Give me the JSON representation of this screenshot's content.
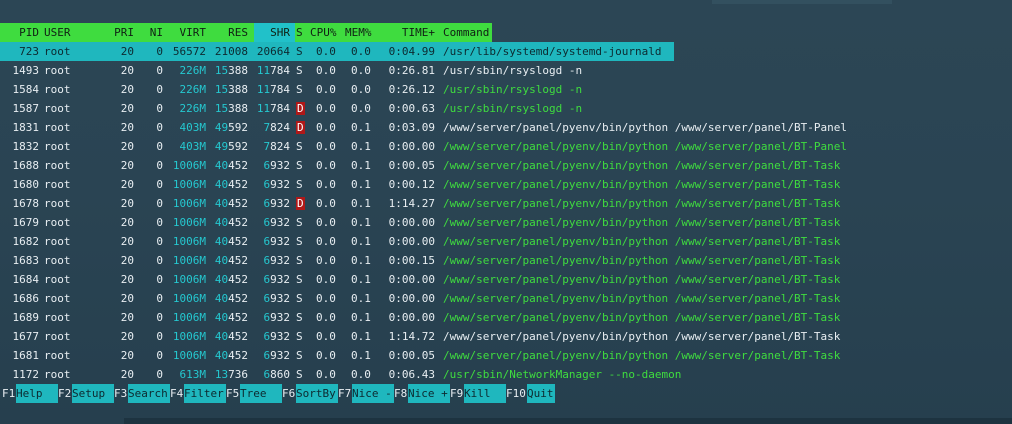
{
  "header": {
    "pid": "PID",
    "user": "USER",
    "pri": "PRI",
    "ni": "NI",
    "virt": "VIRT",
    "res": "RES",
    "shr": "SHR",
    "s": "S",
    "cpu": "CPU%",
    "mem": "MEM%",
    "time": "TIME+",
    "command": "Command"
  },
  "processes": [
    {
      "pid": "723",
      "user": "root",
      "pri": "20",
      "ni": "0",
      "virt": "56572",
      "res": "21008",
      "shr": "20664",
      "s": "S",
      "cpu": "0.0",
      "mem": "0.0",
      "time": "0:04.99",
      "command": "/usr/lib/systemd/systemd-journald"
    },
    {
      "pid": "1493",
      "user": "root",
      "pri": "20",
      "ni": "0",
      "virt": "226M",
      "res": "15388",
      "shr": "11784",
      "s": "S",
      "cpu": "0.0",
      "mem": "0.0",
      "time": "0:26.81",
      "command": "/usr/sbin/rsyslogd -n"
    },
    {
      "pid": "1584",
      "user": "root",
      "pri": "20",
      "ni": "0",
      "virt": "226M",
      "res": "15388",
      "shr": "11784",
      "s": "S",
      "cpu": "0.0",
      "mem": "0.0",
      "time": "0:26.12",
      "command": "/usr/sbin/rsyslogd -n"
    },
    {
      "pid": "1587",
      "user": "root",
      "pri": "20",
      "ni": "0",
      "virt": "226M",
      "res": "15388",
      "shr": "11784",
      "s": "D",
      "cpu": "0.0",
      "mem": "0.0",
      "time": "0:00.63",
      "command": "/usr/sbin/rsyslogd -n"
    },
    {
      "pid": "1831",
      "user": "root",
      "pri": "20",
      "ni": "0",
      "virt": "403M",
      "res": "49592",
      "shr": "7824",
      "s": "D",
      "cpu": "0.0",
      "mem": "0.1",
      "time": "0:03.09",
      "command": "/www/server/panel/pyenv/bin/python /www/server/panel/BT-Panel"
    },
    {
      "pid": "1832",
      "user": "root",
      "pri": "20",
      "ni": "0",
      "virt": "403M",
      "res": "49592",
      "shr": "7824",
      "s": "S",
      "cpu": "0.0",
      "mem": "0.1",
      "time": "0:00.00",
      "command": "/www/server/panel/pyenv/bin/python /www/server/panel/BT-Panel"
    },
    {
      "pid": "1688",
      "user": "root",
      "pri": "20",
      "ni": "0",
      "virt": "1006M",
      "res": "40452",
      "shr": "6932",
      "s": "S",
      "cpu": "0.0",
      "mem": "0.1",
      "time": "0:00.05",
      "command": "/www/server/panel/pyenv/bin/python /www/server/panel/BT-Task"
    },
    {
      "pid": "1680",
      "user": "root",
      "pri": "20",
      "ni": "0",
      "virt": "1006M",
      "res": "40452",
      "shr": "6932",
      "s": "S",
      "cpu": "0.0",
      "mem": "0.1",
      "time": "0:00.12",
      "command": "/www/server/panel/pyenv/bin/python /www/server/panel/BT-Task"
    },
    {
      "pid": "1678",
      "user": "root",
      "pri": "20",
      "ni": "0",
      "virt": "1006M",
      "res": "40452",
      "shr": "6932",
      "s": "D",
      "cpu": "0.0",
      "mem": "0.1",
      "time": "1:14.27",
      "command": "/www/server/panel/pyenv/bin/python /www/server/panel/BT-Task"
    },
    {
      "pid": "1679",
      "user": "root",
      "pri": "20",
      "ni": "0",
      "virt": "1006M",
      "res": "40452",
      "shr": "6932",
      "s": "S",
      "cpu": "0.0",
      "mem": "0.1",
      "time": "0:00.00",
      "command": "/www/server/panel/pyenv/bin/python /www/server/panel/BT-Task"
    },
    {
      "pid": "1682",
      "user": "root",
      "pri": "20",
      "ni": "0",
      "virt": "1006M",
      "res": "40452",
      "shr": "6932",
      "s": "S",
      "cpu": "0.0",
      "mem": "0.1",
      "time": "0:00.00",
      "command": "/www/server/panel/pyenv/bin/python /www/server/panel/BT-Task"
    },
    {
      "pid": "1683",
      "user": "root",
      "pri": "20",
      "ni": "0",
      "virt": "1006M",
      "res": "40452",
      "shr": "6932",
      "s": "S",
      "cpu": "0.0",
      "mem": "0.1",
      "time": "0:00.15",
      "command": "/www/server/panel/pyenv/bin/python /www/server/panel/BT-Task"
    },
    {
      "pid": "1684",
      "user": "root",
      "pri": "20",
      "ni": "0",
      "virt": "1006M",
      "res": "40452",
      "shr": "6932",
      "s": "S",
      "cpu": "0.0",
      "mem": "0.1",
      "time": "0:00.00",
      "command": "/www/server/panel/pyenv/bin/python /www/server/panel/BT-Task"
    },
    {
      "pid": "1686",
      "user": "root",
      "pri": "20",
      "ni": "0",
      "virt": "1006M",
      "res": "40452",
      "shr": "6932",
      "s": "S",
      "cpu": "0.0",
      "mem": "0.1",
      "time": "0:00.00",
      "command": "/www/server/panel/pyenv/bin/python /www/server/panel/BT-Task"
    },
    {
      "pid": "1689",
      "user": "root",
      "pri": "20",
      "ni": "0",
      "virt": "1006M",
      "res": "40452",
      "shr": "6932",
      "s": "S",
      "cpu": "0.0",
      "mem": "0.1",
      "time": "0:00.00",
      "command": "/www/server/panel/pyenv/bin/python /www/server/panel/BT-Task"
    },
    {
      "pid": "1677",
      "user": "root",
      "pri": "20",
      "ni": "0",
      "virt": "1006M",
      "res": "40452",
      "shr": "6932",
      "s": "S",
      "cpu": "0.0",
      "mem": "0.1",
      "time": "1:14.72",
      "command": "/www/server/panel/pyenv/bin/python /www/server/panel/BT-Task"
    },
    {
      "pid": "1681",
      "user": "root",
      "pri": "20",
      "ni": "0",
      "virt": "1006M",
      "res": "40452",
      "shr": "6932",
      "s": "S",
      "cpu": "0.0",
      "mem": "0.1",
      "time": "0:00.05",
      "command": "/www/server/panel/pyenv/bin/python /www/server/panel/BT-Task"
    },
    {
      "pid": "1172",
      "user": "root",
      "pri": "20",
      "ni": "0",
      "virt": "613M",
      "res": "13736",
      "shr": "6860",
      "s": "S",
      "cpu": "0.0",
      "mem": "0.0",
      "time": "0:06.43",
      "command": "/usr/sbin/NetworkManager --no-daemon"
    }
  ],
  "footer": [
    {
      "key": "F1",
      "label": "Help"
    },
    {
      "key": "F2",
      "label": "Setup"
    },
    {
      "key": "F3",
      "label": "Search"
    },
    {
      "key": "F4",
      "label": "Filter"
    },
    {
      "key": "F5",
      "label": "Tree"
    },
    {
      "key": "F6",
      "label": "SortBy"
    },
    {
      "key": "F7",
      "label": "Nice -"
    },
    {
      "key": "F8",
      "label": "Nice +"
    },
    {
      "key": "F9",
      "label": "Kill"
    },
    {
      "key": "F10",
      "label": "Quit"
    }
  ]
}
